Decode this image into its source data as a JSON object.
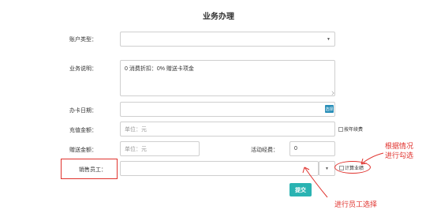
{
  "page": {
    "title": "业务办理"
  },
  "form": {
    "account_type": {
      "label": "账户类型：",
      "value": ""
    },
    "description": {
      "label": "业务说明：",
      "value": "0  消费折扣：0%   赠送卡项金"
    },
    "card_date": {
      "label": "办卡日期：",
      "value": "",
      "button_label": "选择"
    },
    "recharge_amount": {
      "label": "充值金额：",
      "placeholder": "单位：元",
      "option_label": "按年续费"
    },
    "bonus_amount": {
      "label": "赠送金额：",
      "placeholder": "单位：元"
    },
    "activity_fee": {
      "label": "活动经费：",
      "value": "0"
    },
    "sales_staff": {
      "label": "销售员工：",
      "value": "",
      "option_label": "计算业绩"
    },
    "submit_label": "提交"
  },
  "annotations": {
    "staff_select_note": "进行员工选择",
    "check_note_line1": "根据情况",
    "check_note_line2": "进行勾选"
  },
  "colors": {
    "accent": "#2ab3b2",
    "annotation": "#e0322d"
  }
}
